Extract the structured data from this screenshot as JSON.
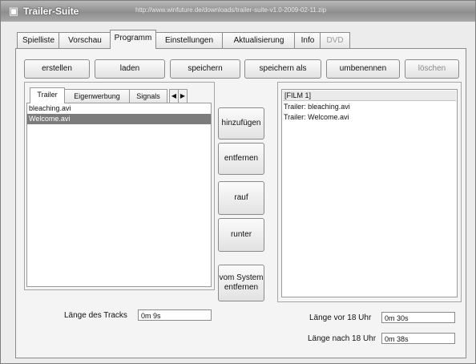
{
  "window": {
    "title": "Trailer-Suite",
    "title_url": "http://www.winfuture.de/downloads/trailer-suite-v1.0-2009-02-11.zip"
  },
  "main_tabs": [
    {
      "label": "Spielliste",
      "state": "normal"
    },
    {
      "label": "Vorschau",
      "state": "normal"
    },
    {
      "label": "Programm",
      "state": "active"
    },
    {
      "label": "Einstellungen",
      "state": "normal"
    },
    {
      "label": "Aktualisierung",
      "state": "normal"
    },
    {
      "label": "Info",
      "state": "normal"
    },
    {
      "label": "DVD",
      "state": "disabled"
    }
  ],
  "toolbar": {
    "create": "erstellen",
    "load": "laden",
    "save": "speichern",
    "save_as": "speichern als",
    "rename": "umbenennen",
    "delete": "löschen"
  },
  "left_subtabs": [
    {
      "label": "Trailer",
      "state": "active"
    },
    {
      "label": "Eigenwerbung",
      "state": "normal"
    },
    {
      "label": "Signals",
      "state": "normal"
    }
  ],
  "left_list": [
    {
      "text": "bleaching.avi",
      "selected": false
    },
    {
      "text": "Welcome.avi",
      "selected": true
    }
  ],
  "actions": {
    "insert": "hinzufügen",
    "remove": "entfernen",
    "up": "rauf",
    "down": "runter",
    "remove_system": "vom System entfernen"
  },
  "films": {
    "header": "[FILM 1]",
    "items": [
      "Trailer: bleaching.avi",
      "Trailer: Welcome.avi"
    ]
  },
  "footer": {
    "track_length_label": "Länge des Tracks",
    "track_length_value": "0m 9s",
    "before_label": "Länge vor 18 Uhr",
    "before_value": "0m 30s",
    "after_label": "Länge nach 18 Uhr",
    "after_value": "0m 38s"
  }
}
